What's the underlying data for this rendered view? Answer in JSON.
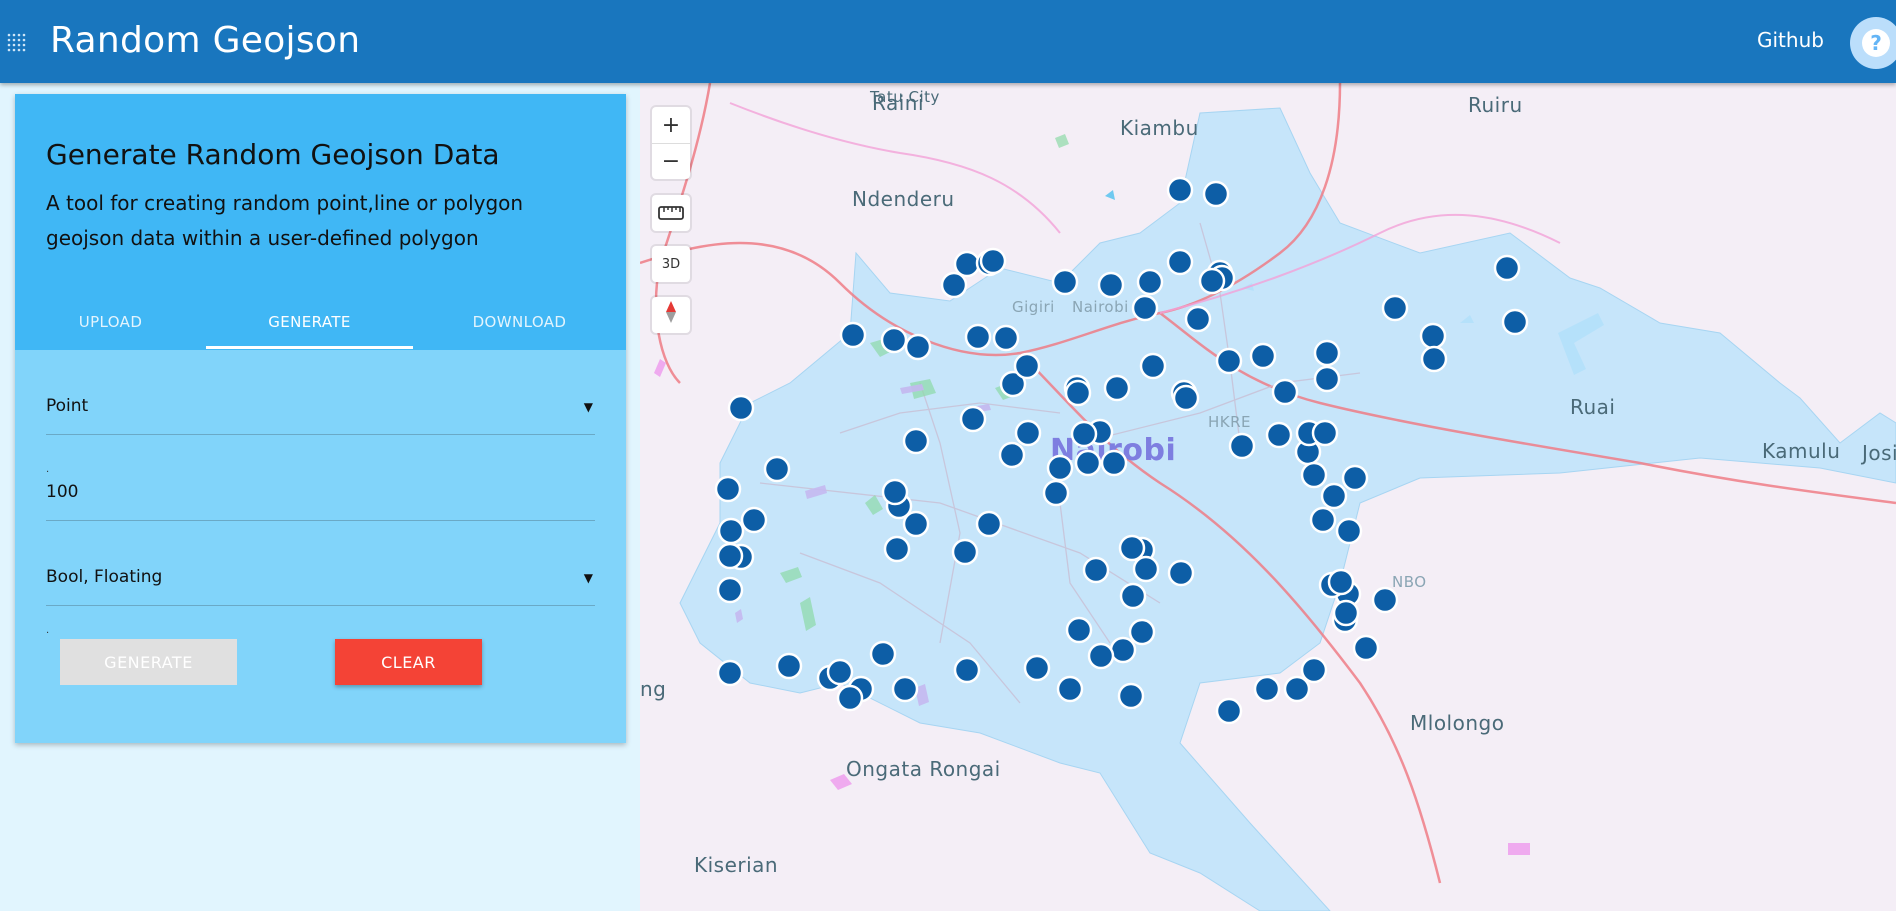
{
  "header": {
    "title": "Random Geojson",
    "github_label": "Github",
    "help_label": "?"
  },
  "card": {
    "title": "Generate Random Geojson Data",
    "description": "A tool for creating random point,line or polygon geojson data within a user-defined polygon",
    "tabs": [
      {
        "label": "UPLOAD",
        "active": false
      },
      {
        "label": "GENERATE",
        "active": true
      },
      {
        "label": "DOWNLOAD",
        "active": false
      }
    ],
    "geometry_type": "Point",
    "count_value": "100",
    "properties_value": "Bool, Floating",
    "generate_label": "GENERATE",
    "clear_label": "CLEAR"
  },
  "map": {
    "controls": {
      "zoom_in": "+",
      "zoom_out": "−",
      "three_d": "3D"
    },
    "places": [
      {
        "label": "Raini"
      },
      {
        "label": "Kiambu"
      },
      {
        "label": "Ruiru"
      },
      {
        "label": "Ndenderu"
      },
      {
        "label": "Gigiri"
      },
      {
        "label": "Nairobi"
      },
      {
        "label": "Nairobi"
      },
      {
        "label": "HKRE"
      },
      {
        "label": "NBO"
      },
      {
        "label": "Ruai"
      },
      {
        "label": "Kamulu"
      },
      {
        "label": "Josi"
      },
      {
        "label": "Ongata Rongai"
      },
      {
        "label": "Mlolongo"
      },
      {
        "label": "Kiserian"
      },
      {
        "label": "Tatu City"
      },
      {
        "label": "ng"
      }
    ],
    "colors": {
      "polygon_fill": "#bfe4fa",
      "point_fill": "#0d5ea6",
      "point_stroke": "#ffffff",
      "highway": "#ef7d86",
      "road": "#f2a1d8"
    }
  }
}
